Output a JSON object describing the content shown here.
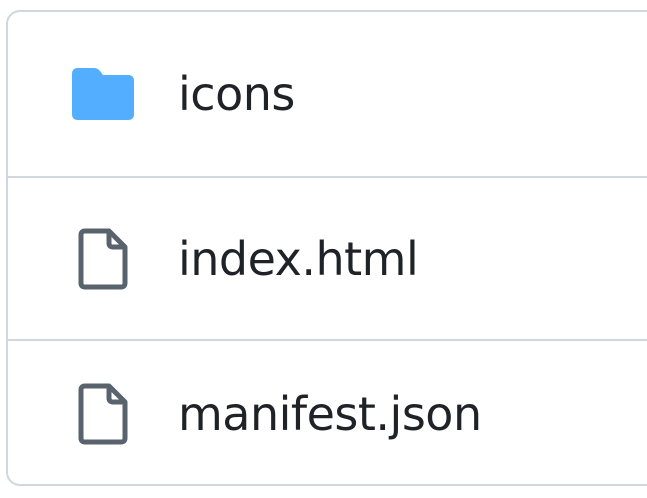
{
  "file_list": {
    "items": [
      {
        "name": "icons",
        "type": "folder",
        "icon": "folder-icon",
        "icon_color": "#54aeff"
      },
      {
        "name": "index.html",
        "type": "file",
        "icon": "file-icon",
        "icon_color": "#59636e"
      },
      {
        "name": "manifest.json",
        "type": "file",
        "icon": "file-icon",
        "icon_color": "#59636e"
      }
    ]
  }
}
